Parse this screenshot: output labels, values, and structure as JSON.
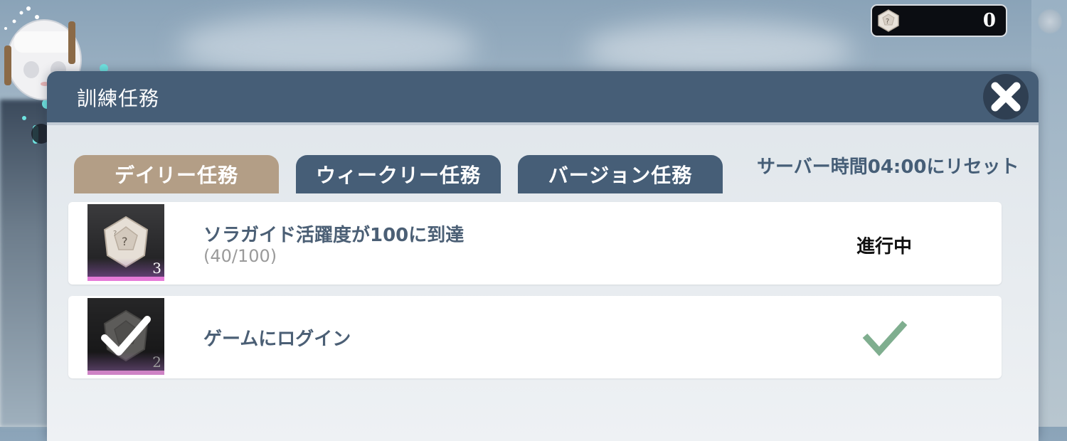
{
  "header": {
    "title": "訓練任務"
  },
  "currency": {
    "value": "0",
    "icon": "dice-icon"
  },
  "tabs": [
    {
      "label": "デイリー任務",
      "active": true
    },
    {
      "label": "ウィークリー任務",
      "active": false
    },
    {
      "label": "バージョン任務",
      "active": false
    }
  ],
  "reset_note": "サーバー時間04:00にリセット",
  "missions": [
    {
      "title": "ソラガイド活躍度が100に到達",
      "progress": "(40/100)",
      "status": "進行中",
      "reward_qty": "3",
      "reward_icon": "dice-icon",
      "completed": false
    },
    {
      "title": "ゲームにログイン",
      "status_icon": "checkmark-icon",
      "reward_qty": "2",
      "reward_icon": "dice-icon",
      "completed": true
    }
  ],
  "colors": {
    "header": "#465e77",
    "active_tab": "#b39e86",
    "inactive_tab": "#465e77",
    "check": "#7fae8f",
    "reward_bar": "#e57ad8"
  }
}
